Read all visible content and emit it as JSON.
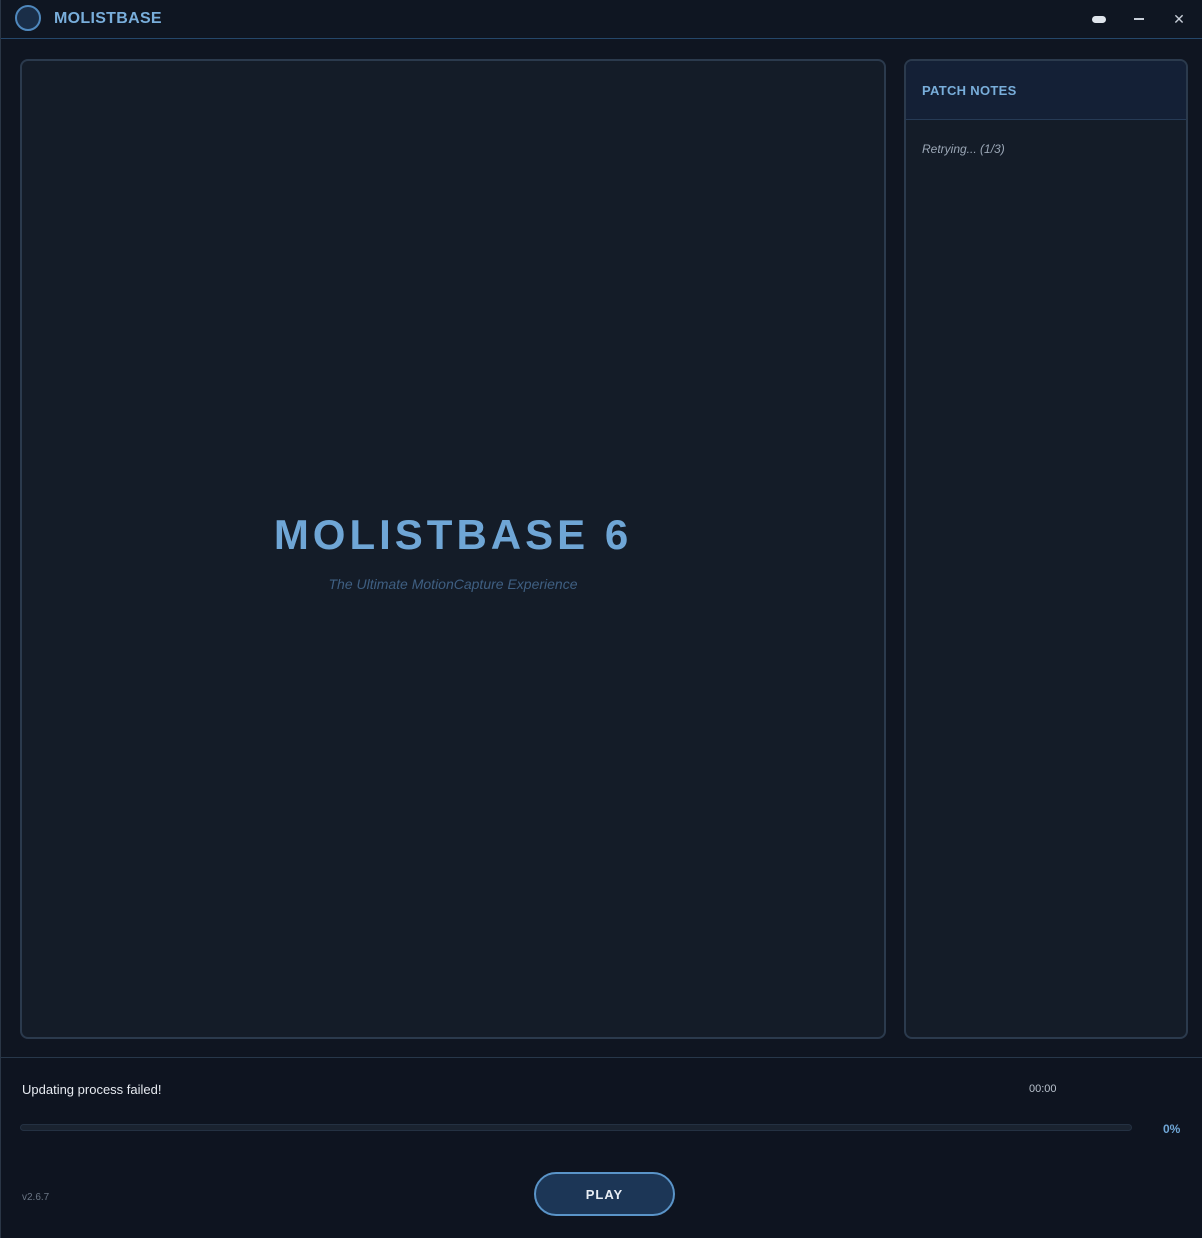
{
  "app": {
    "title": "MOLISTBASE",
    "logo_icon": "circle-logo-icon",
    "controls": {
      "pill_icon": "pill-toggle-icon",
      "minimize_icon": "minimize-icon",
      "close_icon": "close-icon",
      "close_glyph": "✕"
    }
  },
  "hero": {
    "title": "MOLISTBASE 6",
    "subtitle": "The Ultimate MotionCapture Experience"
  },
  "patch_notes": {
    "title": "PATCH NOTES",
    "body": "Retrying... (1/3)"
  },
  "footer": {
    "status": "Updating process failed!",
    "timer": "00:00",
    "progress_percent": 0,
    "progress_label": "0%",
    "version": "v2.6.7",
    "play_label": "PLAY"
  },
  "colors": {
    "accent": "#6fa6d6",
    "panel_bg": "#141c28",
    "window_bg": "#0f1521",
    "button_border": "#5a94c8"
  }
}
